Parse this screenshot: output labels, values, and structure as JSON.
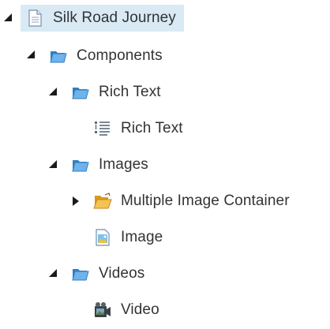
{
  "tree": {
    "root": {
      "label": "Silk Road Journey",
      "icon": "page-icon",
      "expanded": true,
      "selected": true
    },
    "components": {
      "label": "Components",
      "icon": "folder-icon",
      "expanded": true
    },
    "rich_text_folder": {
      "label": "Rich Text",
      "icon": "folder-icon",
      "expanded": true
    },
    "rich_text_item": {
      "label": "Rich Text",
      "icon": "rich-text-icon"
    },
    "images_folder": {
      "label": "Images",
      "icon": "folder-icon",
      "expanded": true
    },
    "multiple_image_container": {
      "label": "Multiple Image Container",
      "icon": "open-folder-icon",
      "expanded": false
    },
    "image_item": {
      "label": "Image",
      "icon": "image-icon"
    },
    "videos_folder": {
      "label": "Videos",
      "icon": "folder-icon",
      "expanded": true
    },
    "video_item": {
      "label": "Video",
      "icon": "video-icon"
    }
  },
  "colors": {
    "selection": "#d9eaf5",
    "folder": "#3b8fd4",
    "text": "#333333",
    "toggle": "#1a1a1a"
  }
}
